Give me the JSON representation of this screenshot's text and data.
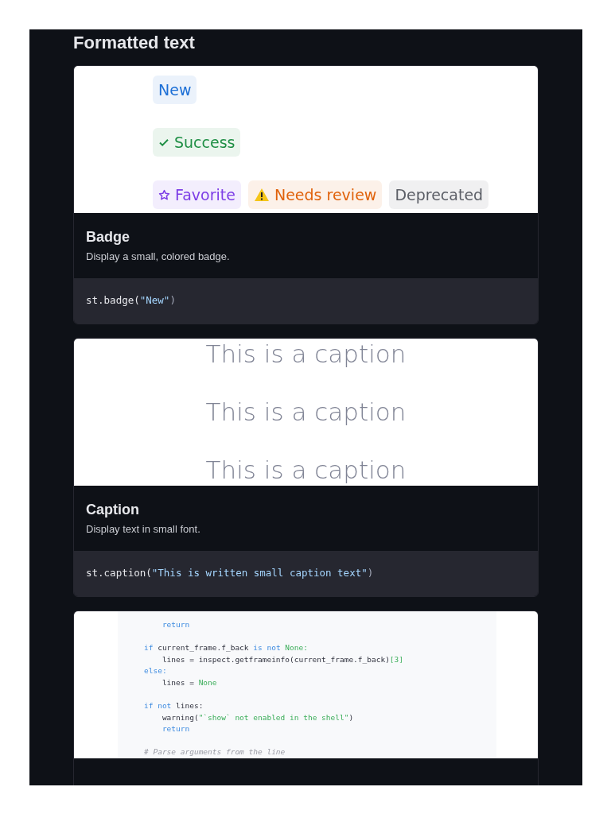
{
  "section_title": "Formatted text",
  "cards": [
    {
      "kind": "badges",
      "badge_rows": [
        [
          {
            "label": "New",
            "color": "#1c6fd6",
            "kind": "plain"
          }
        ],
        [
          {
            "label": "Success",
            "color": "#1f8f45",
            "kind": "check"
          }
        ],
        [
          {
            "label": "Favorite",
            "color": "#7d3ee6",
            "kind": "star"
          },
          {
            "label": "Needs review",
            "color": "#e0620b",
            "kind": "warning"
          },
          {
            "label": "Deprecated",
            "color": "#5b5e66",
            "kind": "plain"
          }
        ]
      ],
      "title": "Badge",
      "description": "Display a small, colored badge.",
      "code": [
        {
          "text": "st.badge(",
          "kind": "plain"
        },
        {
          "text": "\"New\"",
          "kind": "string"
        },
        {
          "text": ")",
          "kind": "punct"
        }
      ]
    },
    {
      "kind": "captions",
      "captions": [
        "This is a caption",
        "This is a caption",
        "This is a caption"
      ],
      "title": "Caption",
      "description": "Display text in small font.",
      "code": [
        {
          "text": "st.caption(",
          "kind": "plain"
        },
        {
          "text": "\"This is written small caption text\"",
          "kind": "string"
        },
        {
          "text": ")",
          "kind": "punct"
        }
      ]
    },
    {
      "kind": "code_preview",
      "lines": [
        {
          "kind": "code",
          "tokens": [
            {
              "text": "    return",
              "kind": "keyword"
            }
          ]
        },
        {
          "kind": "blank"
        },
        {
          "kind": "code",
          "tokens": [
            {
              "text": "if",
              "kind": "keyword"
            },
            {
              "text": " current_frame.f_back ",
              "kind": "plain"
            },
            {
              "text": "is not",
              "kind": "keyword"
            },
            {
              "text": " None:",
              "kind": "literal"
            }
          ]
        },
        {
          "kind": "code",
          "tokens": [
            {
              "text": "    lines = inspect.getframeinfo(current_frame.f_back)",
              "kind": "plain"
            },
            {
              "text": "[3]",
              "kind": "literal"
            }
          ]
        },
        {
          "kind": "code",
          "tokens": [
            {
              "text": "else:",
              "kind": "keyword"
            }
          ]
        },
        {
          "kind": "code",
          "tokens": [
            {
              "text": "    lines = ",
              "kind": "plain"
            },
            {
              "text": "None",
              "kind": "literal"
            }
          ]
        },
        {
          "kind": "blank"
        },
        {
          "kind": "code",
          "tokens": [
            {
              "text": "if not",
              "kind": "keyword"
            },
            {
              "text": " lines:",
              "kind": "plain"
            }
          ]
        },
        {
          "kind": "code",
          "tokens": [
            {
              "text": "    warning(",
              "kind": "plain"
            },
            {
              "text": "\"`show` not enabled in the shell\"",
              "kind": "literal"
            },
            {
              "text": ")",
              "kind": "plain"
            }
          ]
        },
        {
          "kind": "code",
          "tokens": [
            {
              "text": "    return",
              "kind": "keyword"
            }
          ]
        },
        {
          "kind": "blank"
        },
        {
          "kind": "code",
          "tokens": [
            {
              "text": "# Parse arguments from the line",
              "kind": "comment"
            }
          ]
        }
      ]
    }
  ]
}
